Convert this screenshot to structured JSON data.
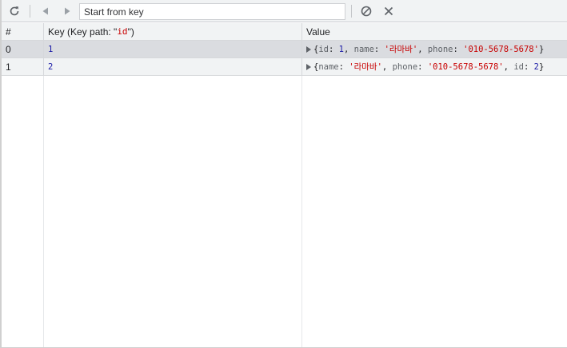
{
  "toolbar": {
    "refresh_icon": "refresh-icon",
    "prev_icon": "prev-page-icon",
    "next_icon": "next-page-icon",
    "search_placeholder": "Start from key",
    "search_value": "",
    "clear_icon": "clear-block-icon",
    "delete_icon": "delete-x-icon"
  },
  "columns": {
    "index": "#",
    "key_prefix": "Key (Key path: \"",
    "key_path": "id",
    "key_suffix": "\")",
    "value": "Value"
  },
  "rows": [
    {
      "index": "0",
      "key": "1",
      "value_parts": [
        {
          "t": "{",
          "c": "punc"
        },
        {
          "t": "id",
          "c": "key"
        },
        {
          "t": ": ",
          "c": "punc"
        },
        {
          "t": "1",
          "c": "num"
        },
        {
          "t": ", ",
          "c": "punc"
        },
        {
          "t": "name",
          "c": "key"
        },
        {
          "t": ": ",
          "c": "punc"
        },
        {
          "t": "'라마바'",
          "c": "str"
        },
        {
          "t": ", ",
          "c": "punc"
        },
        {
          "t": "phone",
          "c": "key"
        },
        {
          "t": ": ",
          "c": "punc"
        },
        {
          "t": "'010-5678-5678'",
          "c": "str"
        },
        {
          "t": "}",
          "c": "punc"
        }
      ]
    },
    {
      "index": "1",
      "key": "2",
      "value_parts": [
        {
          "t": "{",
          "c": "punc"
        },
        {
          "t": "name",
          "c": "key"
        },
        {
          "t": ": ",
          "c": "punc"
        },
        {
          "t": "'라마바'",
          "c": "str"
        },
        {
          "t": ", ",
          "c": "punc"
        },
        {
          "t": "phone",
          "c": "key"
        },
        {
          "t": ": ",
          "c": "punc"
        },
        {
          "t": "'010-5678-5678'",
          "c": "str"
        },
        {
          "t": ", ",
          "c": "punc"
        },
        {
          "t": "id",
          "c": "key"
        },
        {
          "t": ": ",
          "c": "punc"
        },
        {
          "t": "2",
          "c": "num"
        },
        {
          "t": "}",
          "c": "punc"
        }
      ]
    }
  ],
  "colors": {
    "accent": "#1a73e8",
    "number": "#1a1aa6",
    "string": "#c80000"
  }
}
